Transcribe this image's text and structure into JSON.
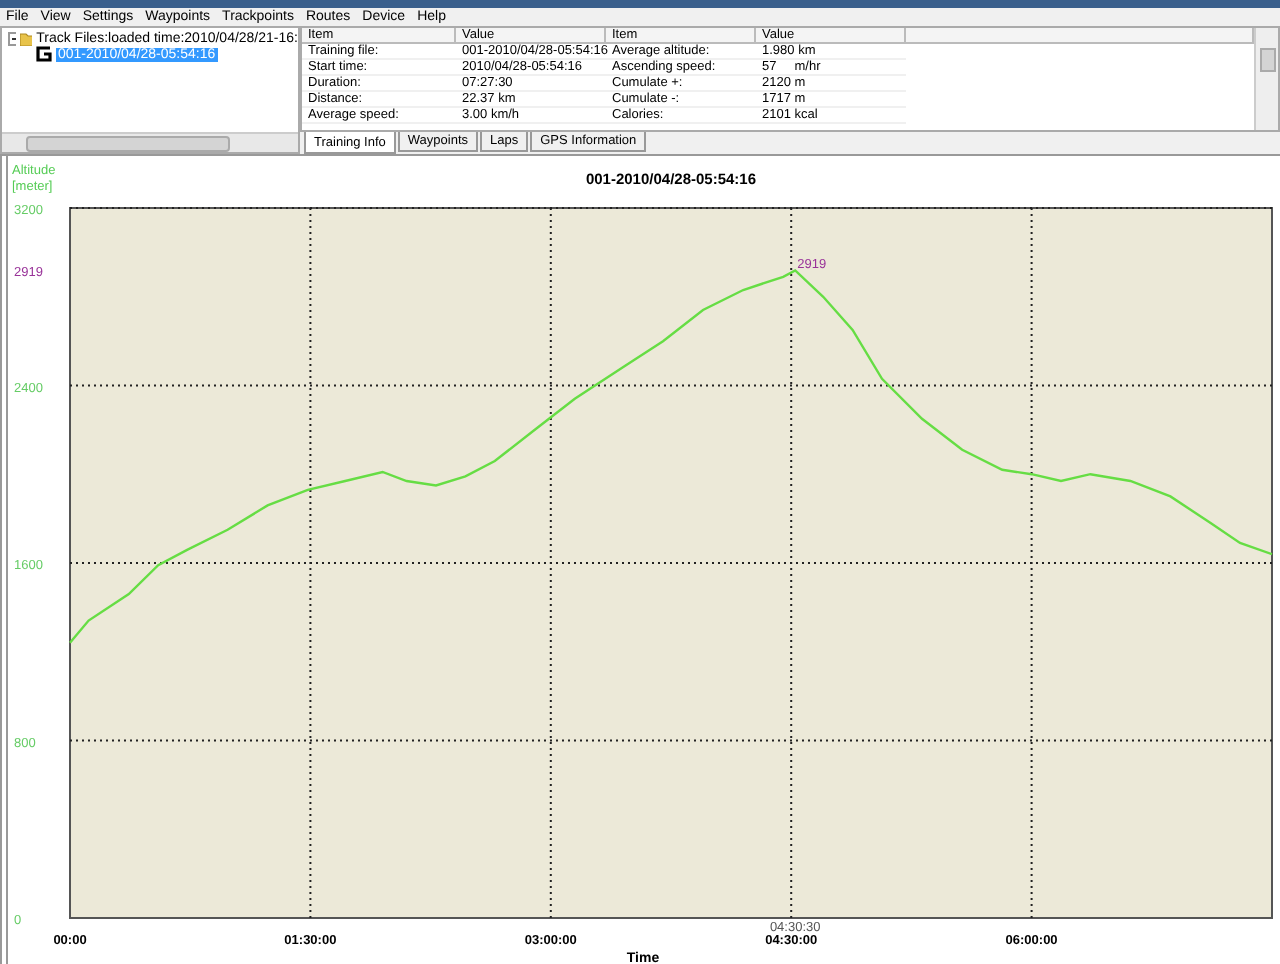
{
  "menu": [
    "File",
    "View",
    "Settings",
    "Waypoints",
    "Trackpoints",
    "Routes",
    "Device",
    "Help"
  ],
  "tree": {
    "label": "Track Files:loaded time:2010/04/28/21-16:",
    "expanded": true,
    "children": [
      {
        "label": "001-2010/04/28-05:54:16",
        "selected": true
      }
    ]
  },
  "info_table": {
    "columns": [
      "Item",
      "Value",
      "Item",
      "Value"
    ],
    "rows": [
      [
        "Training file:",
        "001-2010/04/28-05:54:16",
        "Average altitude:",
        "1.980 km"
      ],
      [
        "Start time:",
        "2010/04/28-05:54:16",
        "Ascending speed:",
        "57     m/hr"
      ],
      [
        "Duration:",
        "07:27:30",
        "Cumulate +:",
        "2120 m"
      ],
      [
        "Distance:",
        "22.37 km",
        "Cumulate -:",
        "1717 m"
      ],
      [
        "Average speed:",
        "3.00 km/h",
        "Calories:",
        "2101 kcal"
      ]
    ]
  },
  "tabs": [
    {
      "label": "Training Info",
      "selected": true
    },
    {
      "label": "Waypoints",
      "selected": false
    },
    {
      "label": "Laps",
      "selected": false
    },
    {
      "label": "GPS Information",
      "selected": false
    }
  ],
  "chart": {
    "chart_data": {
      "type": "line",
      "title": "001-2010/04/28-05:54:16",
      "xlabel": "Time",
      "ylabel": "Altitude [meter]",
      "x": [
        0,
        7,
        22,
        33,
        44,
        59,
        74,
        89,
        103,
        117,
        126,
        137,
        148,
        159,
        174,
        189,
        208,
        222,
        237,
        252,
        267,
        271.5,
        282,
        293,
        304,
        319,
        334,
        349,
        360,
        371,
        382,
        397,
        412,
        427,
        438,
        450
      ],
      "series": [
        {
          "color": "#66dd44",
          "values": [
            1240,
            1340,
            1460,
            1590,
            1660,
            1750,
            1860,
            1930,
            1970,
            2010,
            1970,
            1950,
            1990,
            2060,
            2200,
            2340,
            2490,
            2600,
            2740,
            2830,
            2890,
            2919,
            2800,
            2650,
            2430,
            2250,
            2110,
            2020,
            2000,
            1970,
            2000,
            1970,
            1900,
            1780,
            1690,
            1640
          ]
        }
      ],
      "xlim": [
        0,
        450
      ],
      "ylim": [
        0,
        3200
      ],
      "grid": true,
      "xticks": [
        {
          "value": 0,
          "label": "00:00"
        },
        {
          "value": 90,
          "label": "01:30:00"
        },
        {
          "value": 180,
          "label": "03:00:00"
        },
        {
          "value": 270,
          "label": "04:30:00"
        },
        {
          "value": 360,
          "label": "06:00:00"
        }
      ],
      "yticks": [
        0,
        800,
        1600,
        2400,
        2919,
        3200
      ],
      "annotations": [
        {
          "x": 271.5,
          "y": 2919,
          "text": "2919"
        },
        "04:30:30"
      ]
    }
  }
}
